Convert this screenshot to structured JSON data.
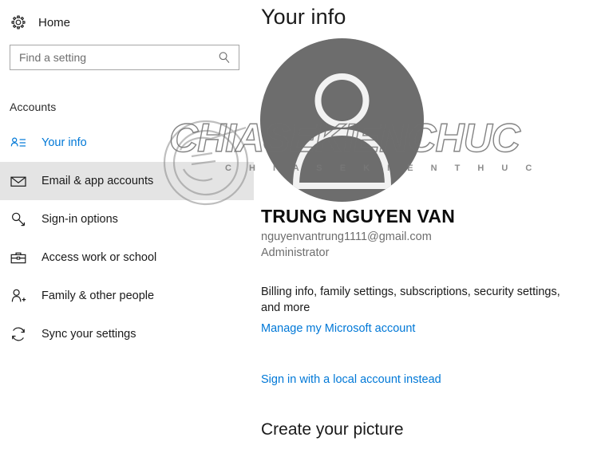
{
  "accent_color": "#0078D7",
  "sidebar": {
    "home": {
      "label": "Home",
      "icon": "gear-icon"
    },
    "search": {
      "value": "",
      "placeholder": "Find a setting",
      "icon": "search-icon"
    },
    "section_title": "Accounts",
    "items": [
      {
        "label": "Your info",
        "icon": "contact-card-icon",
        "state": "selected"
      },
      {
        "label": "Email & app accounts",
        "icon": "envelope-icon",
        "state": "hovered"
      },
      {
        "label": "Sign-in options",
        "icon": "key-icon",
        "state": "normal"
      },
      {
        "label": "Access work or school",
        "icon": "briefcase-icon",
        "state": "normal"
      },
      {
        "label": "Family & other people",
        "icon": "person-add-icon",
        "state": "normal"
      },
      {
        "label": "Sync your settings",
        "icon": "sync-icon",
        "state": "normal"
      }
    ]
  },
  "main": {
    "title": "Your info",
    "avatar": {
      "icon": "default-user-avatar-icon",
      "background_color": "#6D6D6D"
    },
    "user": {
      "display_name": "TRUNG NGUYEN VAN",
      "email": "nguyenvantrung1111@gmail.com",
      "account_type": "Administrator"
    },
    "billing_text": "Billing info, family settings, subscriptions, security settings, and more",
    "manage_account_link": "Manage my Microsoft account",
    "local_account_link": "Sign in with a local account instead",
    "create_picture_heading": "Create your picture"
  },
  "watermark": {
    "title": "CHIASEKIENCHUC",
    "subtitle": "C H I A S E K I E N T H U C"
  }
}
